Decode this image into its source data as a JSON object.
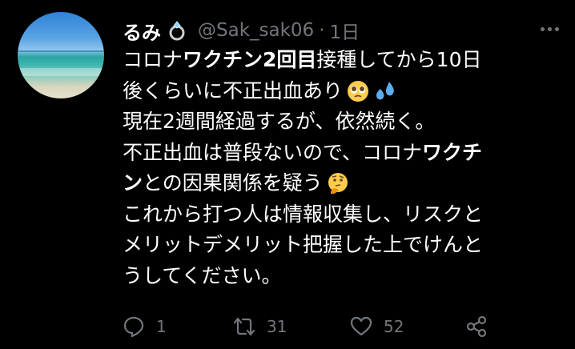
{
  "tweet": {
    "author_name": "るみ",
    "handle": "@Sak_sak06",
    "separator": "·",
    "time": "1日",
    "lines": [
      [
        {
          "t": "コロナ",
          "b": false
        },
        {
          "t": "ワクチン2回目",
          "b": true
        },
        {
          "t": "接種してから10日",
          "b": false
        }
      ],
      [
        {
          "t": "後くらいに不正出血あり",
          "b": false
        }
      ],
      [
        {
          "t": "現在2週間経過するが、依然続く。",
          "b": false
        }
      ],
      [
        {
          "t": "不正出血は普段ないので、コロナ",
          "b": false
        },
        {
          "t": "ワクチ",
          "b": true
        }
      ],
      [
        {
          "t": "ン",
          "b": true
        },
        {
          "t": "との因果関係を疑う",
          "b": false
        }
      ],
      [
        {
          "t": "これから打つ人は情報収集し、リスクと",
          "b": false
        }
      ],
      [
        {
          "t": "メリットデメリット把握した上でけんと",
          "b": false
        }
      ],
      [
        {
          "t": "うしてください。",
          "b": false
        }
      ]
    ],
    "emojis": {
      "name": "ring-icon",
      "line2": [
        "pleading-face-emoji",
        "sweat-droplets-emoji"
      ],
      "line5": [
        "thinking-face-emoji"
      ]
    }
  },
  "actions": {
    "reply_count": "1",
    "retweet_count": "31",
    "like_count": "52"
  },
  "colors": {
    "background": "#000000",
    "text": "#ffffff",
    "muted": "#71767b"
  }
}
